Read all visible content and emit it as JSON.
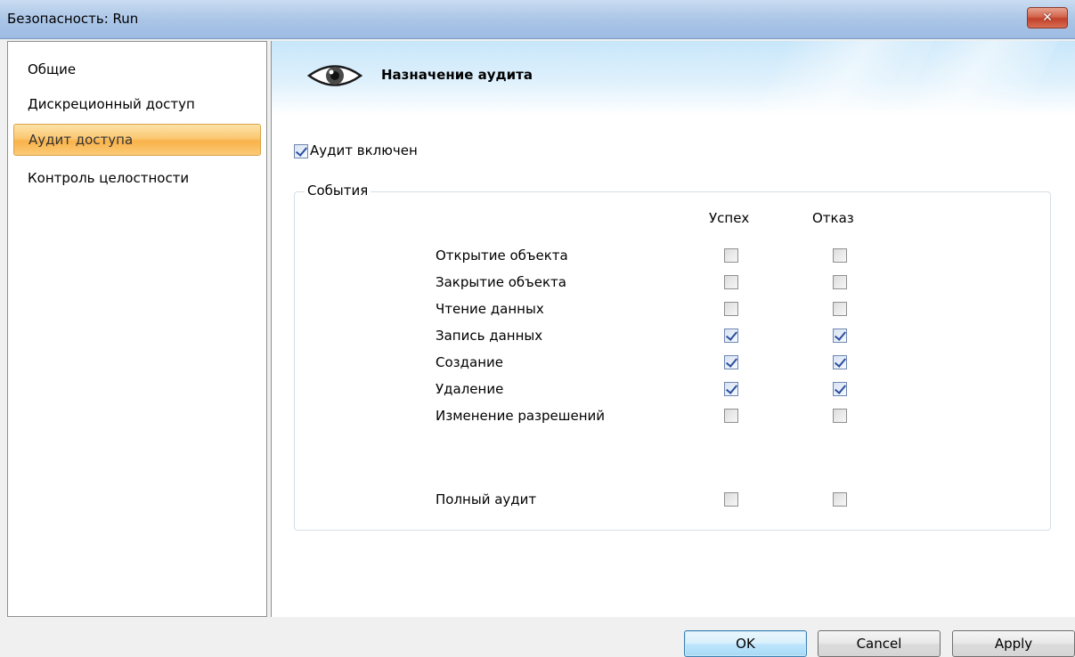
{
  "window": {
    "title": "Безопасность: Run",
    "close_symbol": "✕"
  },
  "nav": {
    "items": [
      {
        "label": "Общие",
        "selected": false
      },
      {
        "label": "Дискреционный доступ",
        "selected": false
      },
      {
        "label": "Аудит доступа",
        "selected": true
      },
      {
        "label": "Контроль целостности",
        "selected": false
      }
    ]
  },
  "header": {
    "icon": "eye-icon",
    "title": "Назначение аудита"
  },
  "audit_enabled": {
    "label": "Аудит включен",
    "checked": true
  },
  "events": {
    "legend": "События",
    "columns": {
      "success": "Успех",
      "failure": "Отказ"
    },
    "rows": [
      {
        "label": "Открытие объекта",
        "success": false,
        "failure": false
      },
      {
        "label": "Закрытие объекта",
        "success": false,
        "failure": false
      },
      {
        "label": "Чтение данных",
        "success": false,
        "failure": false
      },
      {
        "label": "Запись данных",
        "success": true,
        "failure": true
      },
      {
        "label": "Создание",
        "success": true,
        "failure": true
      },
      {
        "label": "Удаление",
        "success": true,
        "failure": true
      },
      {
        "label": "Изменение разрешений",
        "success": false,
        "failure": false
      }
    ],
    "full_audit": {
      "label": "Полный аудит",
      "success": false,
      "failure": false
    }
  },
  "buttons": {
    "ok": "OK",
    "cancel": "Cancel",
    "apply": "Apply"
  },
  "colors": {
    "nav_selected": "#f9b24a",
    "header_band": "#c8e6fa",
    "close_button": "#c2412b",
    "check_mark": "#2b4f9e"
  }
}
